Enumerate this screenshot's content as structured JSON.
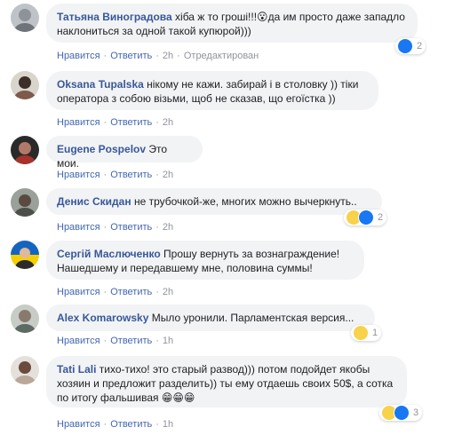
{
  "meta_labels": {
    "like": "Нравится",
    "separator": "·",
    "reply": "Ответить",
    "edited": "Отредактирован"
  },
  "comments": [
    {
      "author": "Татьяна Виноградова",
      "text": "хіба ж то гроші!!!😮да им просто даже западло наклониться за одной такой купюрой)))",
      "time": "2h",
      "edited": true,
      "reactions": {
        "types": [
          "like"
        ],
        "count": "2"
      }
    },
    {
      "author": "Oksana Tupalska",
      "text": "нікому не кажи. забирай і в столовку )) тіки оператора з собою візьми, щоб не сказав, що егоїстка ))",
      "time": "2h"
    },
    {
      "author": "Eugene Pospelov",
      "text": "Это мои.",
      "time": "2h"
    },
    {
      "author": "Денис Скидан",
      "text": "не трубочкой-же, многих можно вычеркнуть..",
      "time": "2h",
      "reactions": {
        "types": [
          "laugh",
          "like"
        ],
        "count": "2"
      }
    },
    {
      "author": "Сергій Маслюченко",
      "text": "Прошу вернуть за вознаграждение! Нашедшему и передавшему мне, половина суммы!",
      "time": "2h"
    },
    {
      "author": "Alex Komarowsky",
      "text": "Мыло уронили. Парламентская версия...",
      "time": "1h",
      "reactions": {
        "types": [
          "laugh"
        ],
        "count": "1"
      }
    },
    {
      "author": "Tati Lali",
      "text": "тихо-тихо! это старый развод))) потом подойдет якобы хозяин и предложит разделить)) ты ему отдаешь своих 50$, а сотка по итогу фальшивая",
      "emojis": "😁😁😁",
      "time": "1h",
      "reactions": {
        "types": [
          "laugh",
          "like"
        ],
        "count": "3"
      }
    }
  ]
}
